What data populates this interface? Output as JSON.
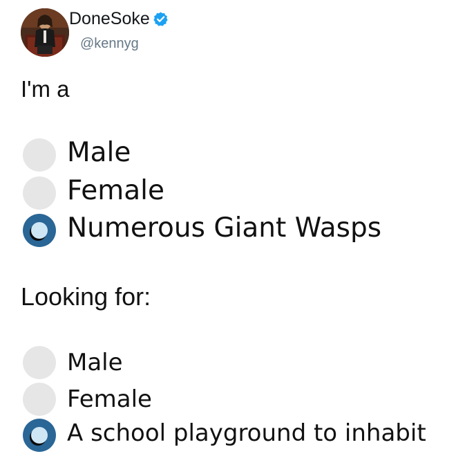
{
  "tweet": {
    "author": {
      "display_name": "DoneSoke",
      "handle": "@kennyg",
      "verified": true,
      "avatar_icon": "profile-photo",
      "verified_color": "#1da1f2"
    },
    "section_one": {
      "heading": "I'm a",
      "options": [
        {
          "label": "Male",
          "checked": false
        },
        {
          "label": "Female",
          "checked": false
        },
        {
          "label": "Numerous Giant Wasps",
          "checked": true
        }
      ]
    },
    "section_two": {
      "heading": "Looking for:",
      "options": [
        {
          "label": "Male",
          "checked": false
        },
        {
          "label": "Female",
          "checked": false
        },
        {
          "label": "A school playground to inhabit",
          "checked": true
        }
      ]
    }
  },
  "colors": {
    "radio_unchecked": "#e6e6e6",
    "radio_checked": "#2a6696",
    "radio_checked_dot": "#cfe6f5",
    "handle_text": "#657786"
  }
}
